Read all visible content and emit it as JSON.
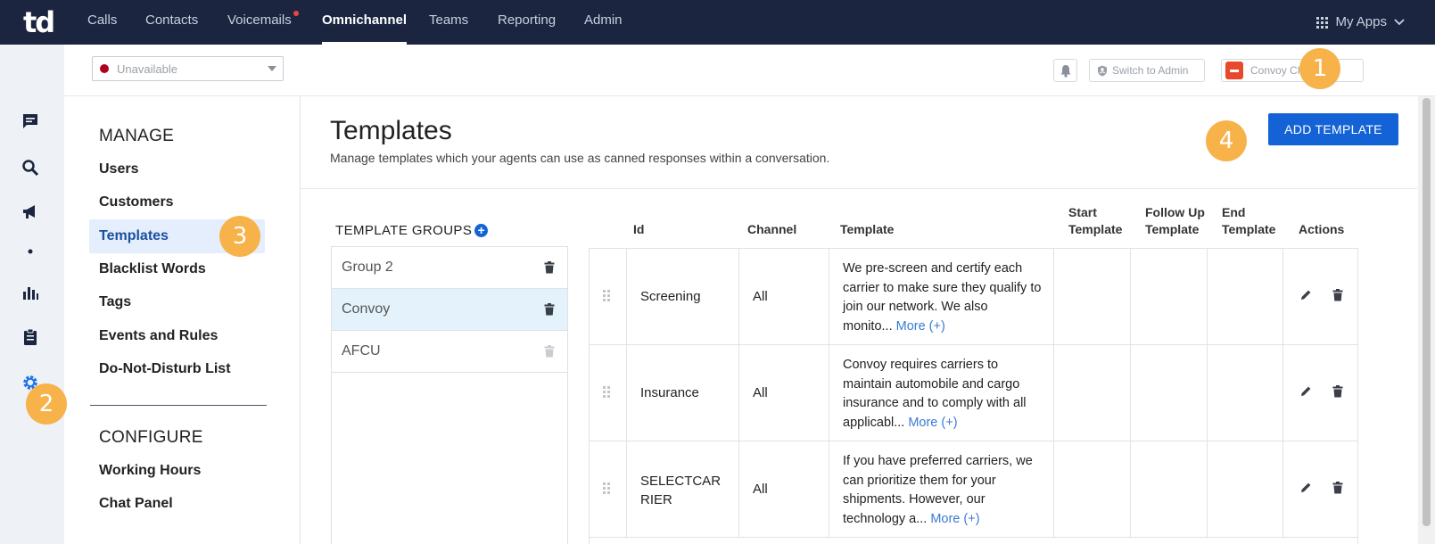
{
  "app": {
    "logo": "td"
  },
  "nav": {
    "items": [
      "Calls",
      "Contacts",
      "Voicemails",
      "Omnichannel",
      "Teams",
      "Reporting",
      "Admin"
    ],
    "active": "Omnichannel",
    "my_apps": "My Apps"
  },
  "subheader": {
    "status": "Unavailable",
    "switch_admin": "Switch to Admin",
    "workspace": "Convoy Chat T..."
  },
  "markers": [
    "1",
    "2",
    "3",
    "4"
  ],
  "sidebar": {
    "manage_title": "MANAGE",
    "manage_items": [
      "Users",
      "Customers",
      "Templates",
      "Blacklist Words",
      "Tags",
      "Events and Rules",
      "Do-Not-Disturb List"
    ],
    "selected": "Templates",
    "configure_title": "CONFIGURE",
    "configure_items": [
      "Working Hours",
      "Chat Panel"
    ]
  },
  "page": {
    "title": "Templates",
    "subtitle": "Manage templates which your agents can use as canned responses within a conversation.",
    "add_button": "ADD TEMPLATE"
  },
  "groups": {
    "title": "TEMPLATE GROUPS",
    "items": [
      {
        "name": "Group 2"
      },
      {
        "name": "Convoy"
      },
      {
        "name": "AFCU"
      }
    ],
    "selected": "Convoy"
  },
  "table": {
    "headers": {
      "id": "Id",
      "channel": "Channel",
      "template": "Template",
      "start_1": "Start",
      "start_2": "Template",
      "follow_1": "Follow Up",
      "follow_2": "Template",
      "end_1": "End",
      "end_2": "Template",
      "actions": "Actions"
    },
    "more_label": "More (+)",
    "rows": [
      {
        "id": "Screening",
        "id2": "",
        "channel": "All",
        "template": "We pre-screen and certify each carrier to make sure they qualify to join our network. We also monito..."
      },
      {
        "id": "Insurance",
        "id2": "",
        "channel": "All",
        "template": "Convoy requires carriers to maintain automobile and cargo insurance and to comply with all applicabl..."
      },
      {
        "id": "SELECTCAR",
        "id2": "RIER",
        "channel": "All",
        "template": "If you have preferred carriers, we can prioritize them for your shipments. However, our technology a..."
      }
    ]
  },
  "colors": {
    "nav_bg": "#1b2540",
    "primary": "#1463d6",
    "marker": "#f7b24a",
    "selected_bg": "#e4eefc"
  }
}
